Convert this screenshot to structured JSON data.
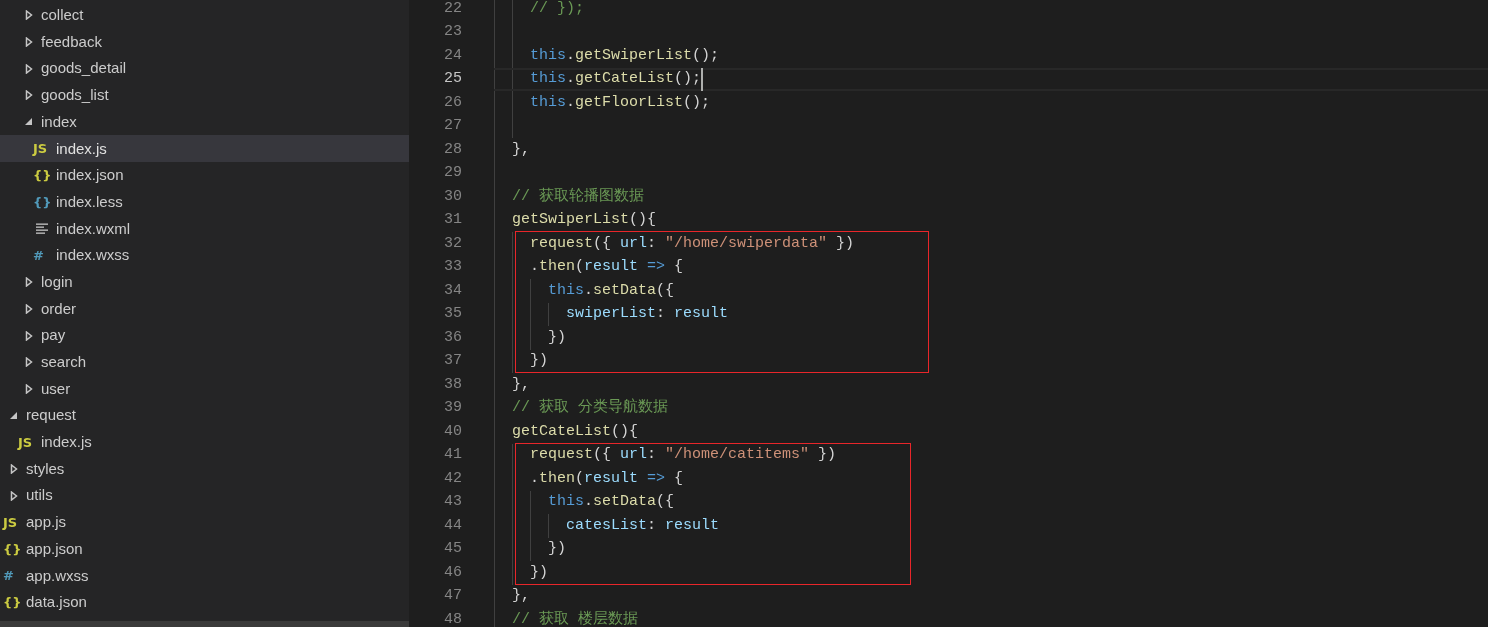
{
  "explorer": {
    "scrolled_folder_children": [
      {
        "label": "collect",
        "kind": "folder",
        "expanded": false,
        "selected": false
      },
      {
        "label": "feedback",
        "kind": "folder",
        "expanded": false,
        "selected": false
      },
      {
        "label": "goods_detail",
        "kind": "folder",
        "expanded": false,
        "selected": false
      },
      {
        "label": "goods_list",
        "kind": "folder",
        "expanded": false,
        "selected": false
      },
      {
        "label": "index",
        "kind": "folder",
        "expanded": true,
        "selected": false,
        "children": [
          {
            "label": "index.js",
            "kind": "js",
            "icon": "JS",
            "selected": true
          },
          {
            "label": "index.json",
            "kind": "json",
            "icon": "{}",
            "selected": false
          },
          {
            "label": "index.less",
            "kind": "less",
            "icon": "{}",
            "selected": false
          },
          {
            "label": "index.wxml",
            "kind": "wxml",
            "selected": false
          },
          {
            "label": "index.wxss",
            "kind": "wxss",
            "icon": "#",
            "selected": false
          }
        ]
      },
      {
        "label": "login",
        "kind": "folder",
        "expanded": false,
        "selected": false
      },
      {
        "label": "order",
        "kind": "folder",
        "expanded": false,
        "selected": false
      },
      {
        "label": "pay",
        "kind": "folder",
        "expanded": false,
        "selected": false
      },
      {
        "label": "search",
        "kind": "folder",
        "expanded": false,
        "selected": false
      },
      {
        "label": "user",
        "kind": "folder",
        "expanded": false,
        "selected": false
      }
    ],
    "items": [
      {
        "label": "request",
        "kind": "folder",
        "expanded": true,
        "selected": false,
        "children": [
          {
            "label": "index.js",
            "kind": "js",
            "icon": "JS",
            "selected": false
          }
        ]
      },
      {
        "label": "styles",
        "kind": "folder",
        "expanded": false,
        "selected": false
      },
      {
        "label": "utils",
        "kind": "folder",
        "expanded": false,
        "selected": false
      },
      {
        "label": "app.js",
        "kind": "js",
        "icon": "JS",
        "selected": false
      },
      {
        "label": "app.json",
        "kind": "json",
        "icon": "{}",
        "selected": false
      },
      {
        "label": "app.wxss",
        "kind": "wxss",
        "icon": "#",
        "selected": false
      },
      {
        "label": "data.json",
        "kind": "json",
        "icon": "{}",
        "selected": false
      }
    ]
  },
  "editor": {
    "segments": [
      {
        "kind": "plain",
        "lines": [
          {
            "number": "22",
            "current": false,
            "tokens": [
              {
                "text": "    // });",
                "kind": "comment"
              }
            ]
          },
          {
            "number": "23",
            "current": false
          },
          {
            "number": "24",
            "current": false,
            "tokens": [
              {
                "text": "    this",
                "kind": "keyword"
              },
              {
                "text": ".",
                "kind": "plain"
              },
              {
                "text": "getSwiperList",
                "kind": "function"
              },
              {
                "text": "();",
                "kind": "plain"
              }
            ]
          },
          {
            "number": "25",
            "current": true,
            "tokens": [
              {
                "text": "    this",
                "kind": "keyword"
              },
              {
                "text": ".",
                "kind": "plain"
              },
              {
                "text": "getCateList",
                "kind": "function"
              },
              {
                "text": "();",
                "kind": "plain"
              }
            ]
          },
          {
            "number": "26",
            "current": false,
            "tokens": [
              {
                "text": "    this",
                "kind": "keyword"
              },
              {
                "text": ".",
                "kind": "plain"
              },
              {
                "text": "getFloorList",
                "kind": "function"
              },
              {
                "text": "();",
                "kind": "plain"
              }
            ]
          },
          {
            "number": "27",
            "current": false
          },
          {
            "number": "28",
            "current": false,
            "tokens": [
              {
                "text": "  },",
                "kind": "plain"
              }
            ]
          },
          {
            "number": "29",
            "current": false
          },
          {
            "number": "30",
            "current": false,
            "tokens": [
              {
                "text": "  // 获取轮播图数据",
                "kind": "comment"
              }
            ]
          },
          {
            "number": "31",
            "current": false,
            "tokens": [
              {
                "text": "  getSwiperList",
                "kind": "function"
              },
              {
                "text": "(){",
                "kind": "plain"
              }
            ]
          }
        ]
      },
      {
        "kind": "red_box",
        "lines": [
          {
            "number": "32",
            "current": false,
            "tokens": [
              {
                "text": "    request",
                "kind": "function"
              },
              {
                "text": "({ ",
                "kind": "plain"
              },
              {
                "text": "url",
                "kind": "variable"
              },
              {
                "text": ": ",
                "kind": "plain"
              },
              {
                "text": "\"/home/swiperdata\"",
                "kind": "string"
              },
              {
                "text": " })",
                "kind": "plain"
              }
            ]
          },
          {
            "number": "33",
            "current": false,
            "tokens": [
              {
                "text": "    .",
                "kind": "plain"
              },
              {
                "text": "then",
                "kind": "function"
              },
              {
                "text": "(",
                "kind": "plain"
              },
              {
                "text": "result ",
                "kind": "variable"
              },
              {
                "text": "=>",
                "kind": "keyword"
              },
              {
                "text": " {",
                "kind": "plain"
              }
            ]
          },
          {
            "number": "34",
            "current": false,
            "tokens": [
              {
                "text": "      this",
                "kind": "keyword"
              },
              {
                "text": ".",
                "kind": "plain"
              },
              {
                "text": "setData",
                "kind": "function"
              },
              {
                "text": "({",
                "kind": "plain"
              }
            ]
          },
          {
            "number": "35",
            "current": false,
            "tokens": [
              {
                "text": "        swiperList",
                "kind": "variable"
              },
              {
                "text": ": ",
                "kind": "plain"
              },
              {
                "text": "result",
                "kind": "variable"
              }
            ]
          },
          {
            "number": "36",
            "current": false,
            "tokens": [
              {
                "text": "      })",
                "kind": "plain"
              }
            ]
          },
          {
            "number": "37",
            "current": false,
            "tokens": [
              {
                "text": "    })",
                "kind": "plain"
              }
            ]
          }
        ]
      },
      {
        "kind": "plain",
        "lines": [
          {
            "number": "38",
            "current": false,
            "tokens": [
              {
                "text": "  },",
                "kind": "plain"
              }
            ]
          },
          {
            "number": "39",
            "current": false,
            "tokens": [
              {
                "text": "  // 获取 分类导航数据",
                "kind": "comment"
              }
            ]
          },
          {
            "number": "40",
            "current": false,
            "tokens": [
              {
                "text": "  getCateList",
                "kind": "function"
              },
              {
                "text": "(){",
                "kind": "plain"
              }
            ]
          }
        ]
      },
      {
        "kind": "red_box",
        "lines": [
          {
            "number": "41",
            "current": false,
            "tokens": [
              {
                "text": "    request",
                "kind": "function"
              },
              {
                "text": "({ ",
                "kind": "plain"
              },
              {
                "text": "url",
                "kind": "variable"
              },
              {
                "text": ": ",
                "kind": "plain"
              },
              {
                "text": "\"/home/catitems\"",
                "kind": "string"
              },
              {
                "text": " })",
                "kind": "plain"
              }
            ]
          },
          {
            "number": "42",
            "current": false,
            "tokens": [
              {
                "text": "    .",
                "kind": "plain"
              },
              {
                "text": "then",
                "kind": "function"
              },
              {
                "text": "(",
                "kind": "plain"
              },
              {
                "text": "result ",
                "kind": "variable"
              },
              {
                "text": "=>",
                "kind": "keyword"
              },
              {
                "text": " {",
                "kind": "plain"
              }
            ]
          },
          {
            "number": "43",
            "current": false,
            "tokens": [
              {
                "text": "      this",
                "kind": "keyword"
              },
              {
                "text": ".",
                "kind": "plain"
              },
              {
                "text": "setData",
                "kind": "function"
              },
              {
                "text": "({",
                "kind": "plain"
              }
            ]
          },
          {
            "number": "44",
            "current": false,
            "tokens": [
              {
                "text": "        catesList",
                "kind": "variable"
              },
              {
                "text": ": ",
                "kind": "plain"
              },
              {
                "text": "result",
                "kind": "variable"
              }
            ]
          },
          {
            "number": "45",
            "current": false,
            "tokens": [
              {
                "text": "      })",
                "kind": "plain"
              }
            ]
          },
          {
            "number": "46",
            "current": false,
            "tokens": [
              {
                "text": "    })",
                "kind": "plain"
              }
            ]
          }
        ]
      },
      {
        "kind": "plain",
        "lines": [
          {
            "number": "47",
            "current": false,
            "tokens": [
              {
                "text": "  },",
                "kind": "plain"
              }
            ]
          },
          {
            "number": "48",
            "current": false,
            "tokens": [
              {
                "text": "  // 获取 楼层数据",
                "kind": "comment"
              }
            ]
          }
        ]
      }
    ]
  }
}
